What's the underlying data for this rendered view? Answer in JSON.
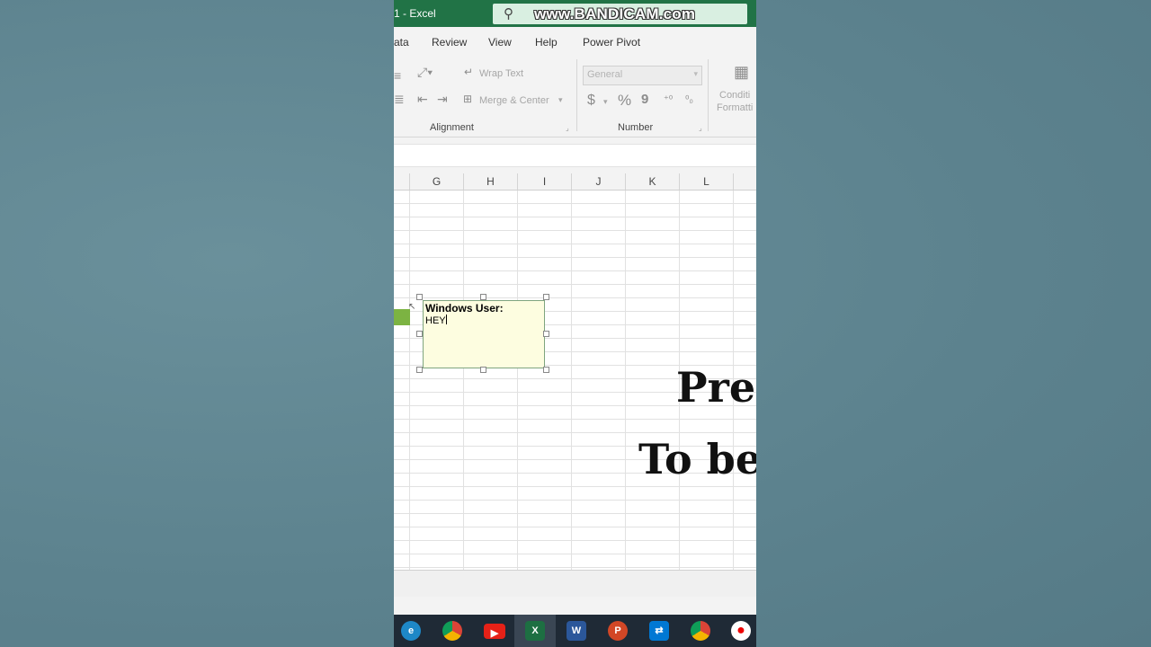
{
  "window": {
    "title": "1 - Excel"
  },
  "watermark": {
    "text": "www.BANDICAM.com"
  },
  "ribbon": {
    "tabs": [
      "ata",
      "Review",
      "View",
      "Help",
      "Power Pivot"
    ],
    "wrap_text": "Wrap Text",
    "merge_center": "Merge & Center",
    "number_format": "General",
    "currency_symbol": "$",
    "percent_symbol": "%",
    "comma_symbol": "9",
    "group_alignment": "Alignment",
    "group_number": "Number",
    "conditional_formatting_line1": "Conditi",
    "conditional_formatting_line2": "Formatti"
  },
  "grid": {
    "columns": [
      "G",
      "H",
      "I",
      "J",
      "K",
      "L"
    ]
  },
  "comment": {
    "author": "Windows User:",
    "text": "HEY"
  },
  "overlay": {
    "line1": "Pres",
    "line2": "To be"
  },
  "taskbar": {
    "apps": [
      "edge-icon",
      "chrome-icon",
      "youtube-icon",
      "excel-icon",
      "word-icon",
      "powerpoint-icon",
      "remote-desktop-icon",
      "chrome-icon-2",
      "record-icon"
    ]
  },
  "colors": {
    "excel_green": "#217346",
    "comment_bg": "#fdfde0",
    "backdrop": "#5f8793"
  }
}
